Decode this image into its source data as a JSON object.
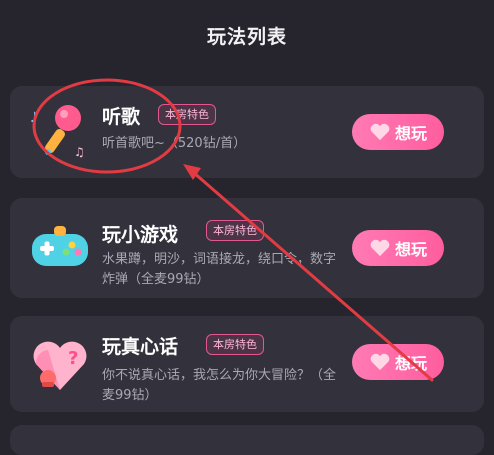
{
  "page": {
    "title": "玩法列表"
  },
  "items": [
    {
      "name": "听歌",
      "badge": "本房特色",
      "desc": "听首歌吧~（520钻/首）",
      "button": "想玩",
      "icon": "microphone-icon"
    },
    {
      "name": "玩小游戏",
      "badge": "本房特色",
      "desc": "水果蹲，明沙，词语接龙，绕口令，数字炸弹（全麦99钻）",
      "button": "想玩",
      "icon": "gamepad-icon"
    },
    {
      "name": "玩真心话",
      "badge": "本房特色",
      "desc": "你不说真心话，我怎么为你大冒险？（全麦99钻）",
      "button": "想玩",
      "icon": "heart-question-icon"
    }
  ],
  "colors": {
    "accent": "#ff6aa8",
    "annotation": "#e23b43",
    "background": "#26252e",
    "card": "#33323c"
  }
}
